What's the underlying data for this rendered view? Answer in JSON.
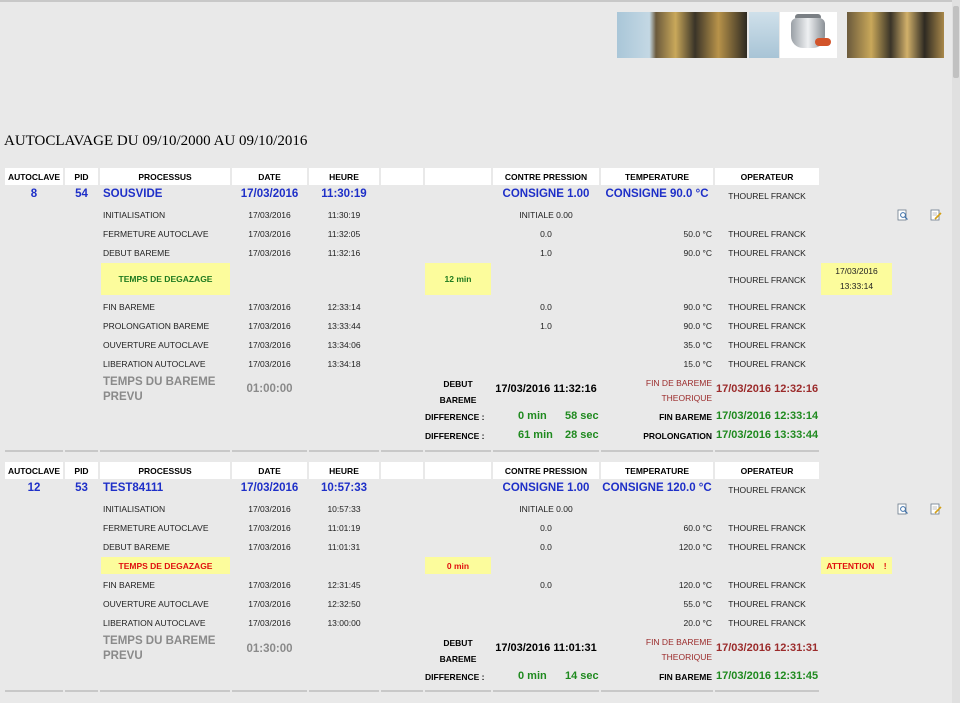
{
  "page": {
    "title": "AUTOCLAVAGE DU 09/10/2000 AU 09/10/2016"
  },
  "headers": [
    "AUTOCLAVE",
    "PID",
    "PROCESSUS",
    "DATE",
    "HEURE",
    "",
    "",
    "CONTRE PRESSION",
    "TEMPERATURE",
    "OPERATEUR"
  ],
  "records": [
    {
      "autoclave": "8",
      "pid": "54",
      "process": "SOUSVIDE",
      "date": "17/03/2016",
      "heure": "11:30:19",
      "consigne_p": "CONSIGNE 1.00",
      "consigne_t": "CONSIGNE 90.0 °C",
      "operateur": "THOUREL FRANCK",
      "steps": [
        {
          "name": "INITIALISATION",
          "date": "17/03/2016",
          "heure": "11:30:19",
          "pression": "INITIALE 0.00",
          "temp": "",
          "op": ""
        },
        {
          "name": "FERMETURE AUTOCLAVE",
          "date": "17/03/2016",
          "heure": "11:32:05",
          "pression": "0.0",
          "temp": "50.0 °C",
          "op": "THOUREL FRANCK"
        },
        {
          "name": "DEBUT BAREME",
          "date": "17/03/2016",
          "heure": "11:32:16",
          "pression": "1.0",
          "temp": "90.0 °C",
          "op": "THOUREL FRANCK"
        }
      ],
      "degazage": {
        "label": "TEMPS DE DEGAZAGE",
        "duree": "12 min",
        "op": "THOUREL FRANCK",
        "status": "17/03/2016 13:33:14"
      },
      "steps2": [
        {
          "name": "FIN BAREME",
          "date": "17/03/2016",
          "heure": "12:33:14",
          "pression": "0.0",
          "temp": "90.0 °C",
          "op": "THOUREL FRANCK"
        },
        {
          "name": "PROLONGATION BAREME",
          "date": "17/03/2016",
          "heure": "13:33:44",
          "pression": "1.0",
          "temp": "90.0 °C",
          "op": "THOUREL FRANCK"
        },
        {
          "name": "OUVERTURE AUTOCLAVE",
          "date": "17/03/2016",
          "heure": "13:34:06",
          "pression": "",
          "temp": "35.0 °C",
          "op": "THOUREL FRANCK"
        },
        {
          "name": "LIBERATION AUTOCLAVE",
          "date": "17/03/2016",
          "heure": "13:34:18",
          "pression": "",
          "temp": "15.0 °C",
          "op": "THOUREL FRANCK"
        }
      ],
      "summary": {
        "bareme_label": "TEMPS DU BAREME PREVU",
        "bareme_time": "01:00:00",
        "debut_label": "DEBUT BAREME",
        "debut_value": "17/03/2016 11:32:16",
        "fin_theo_label": "FIN DE BAREME THEORIQUE",
        "fin_theo_value": "17/03/2016 12:32:16",
        "diff1_label": "DIFFERENCE :",
        "diff1_min": "0 min",
        "diff1_sec": "58 sec",
        "fin_label": "FIN BAREME",
        "fin_value": "17/03/2016 12:33:14",
        "diff2_label": "DIFFERENCE :",
        "diff2_min": "61 min",
        "diff2_sec": "28 sec",
        "prol_label": "PROLONGATION",
        "prol_value": "17/03/2016 13:33:44"
      }
    },
    {
      "autoclave": "12",
      "pid": "53",
      "process": "TEST84111",
      "date": "17/03/2016",
      "heure": "10:57:33",
      "consigne_p": "CONSIGNE 1.00",
      "consigne_t": "CONSIGNE 120.0 °C",
      "operateur": "THOUREL FRANCK",
      "steps": [
        {
          "name": "INITIALISATION",
          "date": "17/03/2016",
          "heure": "10:57:33",
          "pression": "INITIALE 0.00",
          "temp": "",
          "op": ""
        },
        {
          "name": "FERMETURE AUTOCLAVE",
          "date": "17/03/2016",
          "heure": "11:01:19",
          "pression": "0.0",
          "temp": "60.0 °C",
          "op": "THOUREL FRANCK"
        },
        {
          "name": "DEBUT BAREME",
          "date": "17/03/2016",
          "heure": "11:01:31",
          "pression": "0.0",
          "temp": "120.0 °C",
          "op": "THOUREL FRANCK"
        }
      ],
      "degazage": {
        "label": "TEMPS DE DEGAZAGE",
        "duree": "0 min",
        "op": "",
        "status": "ATTENTION    !"
      },
      "steps2": [
        {
          "name": "FIN BAREME",
          "date": "17/03/2016",
          "heure": "12:31:45",
          "pression": "0.0",
          "temp": "120.0 °C",
          "op": "THOUREL FRANCK"
        },
        {
          "name": "OUVERTURE AUTOCLAVE",
          "date": "17/03/2016",
          "heure": "12:32:50",
          "pression": "",
          "temp": "55.0 °C",
          "op": "THOUREL FRANCK"
        },
        {
          "name": "LIBERATION AUTOCLAVE",
          "date": "17/03/2016",
          "heure": "13:00:00",
          "pression": "",
          "temp": "20.0 °C",
          "op": "THOUREL FRANCK"
        }
      ],
      "summary": {
        "bareme_label": "TEMPS DU BAREME PREVU",
        "bareme_time": "01:30:00",
        "debut_label": "DEBUT BAREME",
        "debut_value": "17/03/2016 11:01:31",
        "fin_theo_label": "FIN DE BAREME THEORIQUE",
        "fin_theo_value": "17/03/2016 12:31:31",
        "diff1_label": "DIFFERENCE :",
        "diff1_min": "0 min",
        "diff1_sec": "14 sec",
        "fin_label": "FIN BAREME",
        "fin_value": "17/03/2016 12:31:45"
      }
    }
  ],
  "icons": {
    "view": "magnifier-page-icon",
    "edit": "edit-document-icon"
  }
}
